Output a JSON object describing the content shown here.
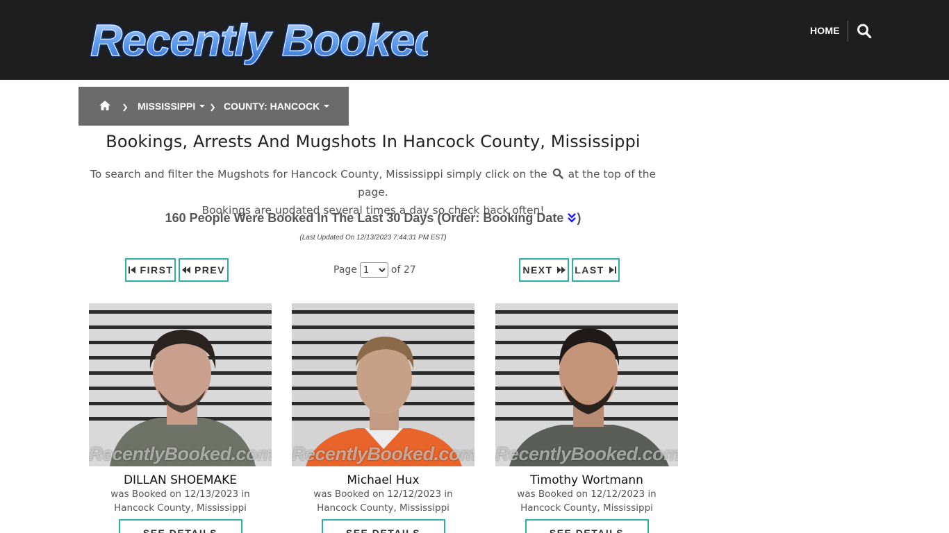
{
  "header": {
    "logo_text": "Recently Booked",
    "nav_home": "HOME",
    "search_icon": "search-icon"
  },
  "breadcrumb": {
    "home_icon": "home-icon",
    "state": "MISSISSIPPI",
    "county": "COUNTY: HANCOCK"
  },
  "main": {
    "title": "Bookings, Arrests And Mugshots In Hancock County, Mississippi",
    "intro_before_icon": "To search and filter the Mugshots for Hancock County, Mississippi simply click on the",
    "intro_after_icon": "at the top of the page.",
    "intro_line2": "Bookings are updated several times a day so check back often!",
    "count_text": "160 People Were Booked In The Last 30 Days (Order: Booking Date",
    "count_close": ")",
    "updated": "(Last Updated On 12/13/2023 7:44:31 PM EST)"
  },
  "pagination": {
    "first": "FIRST",
    "prev": "PREV",
    "next": "NEXT",
    "last": "LAST",
    "page_label": "Page",
    "page_value": "1",
    "of_label": "of 27"
  },
  "watermark": "RecentlyBooked.com",
  "people": [
    {
      "name": "DILLAN SHOEMAKE",
      "booked": "was Booked on 12/13/2023 in",
      "location": "Hancock County, Mississippi",
      "button": "SEE DETAILS"
    },
    {
      "name": "Michael Hux",
      "booked": "was Booked on 12/12/2023 in",
      "location": "Hancock County, Mississippi",
      "button": "SEE DETAILS"
    },
    {
      "name": "Timothy Wortmann",
      "booked": "was Booked on 12/12/2023 in",
      "location": "Hancock County, Mississippi",
      "button": "SEE DETAILS"
    }
  ],
  "colors": {
    "header_bg": "#1e1e1e",
    "breadcrumb_bg": "#6b6b6b",
    "accent_teal": "#2bb0a6",
    "logo_blue": "#4f8fe6"
  }
}
